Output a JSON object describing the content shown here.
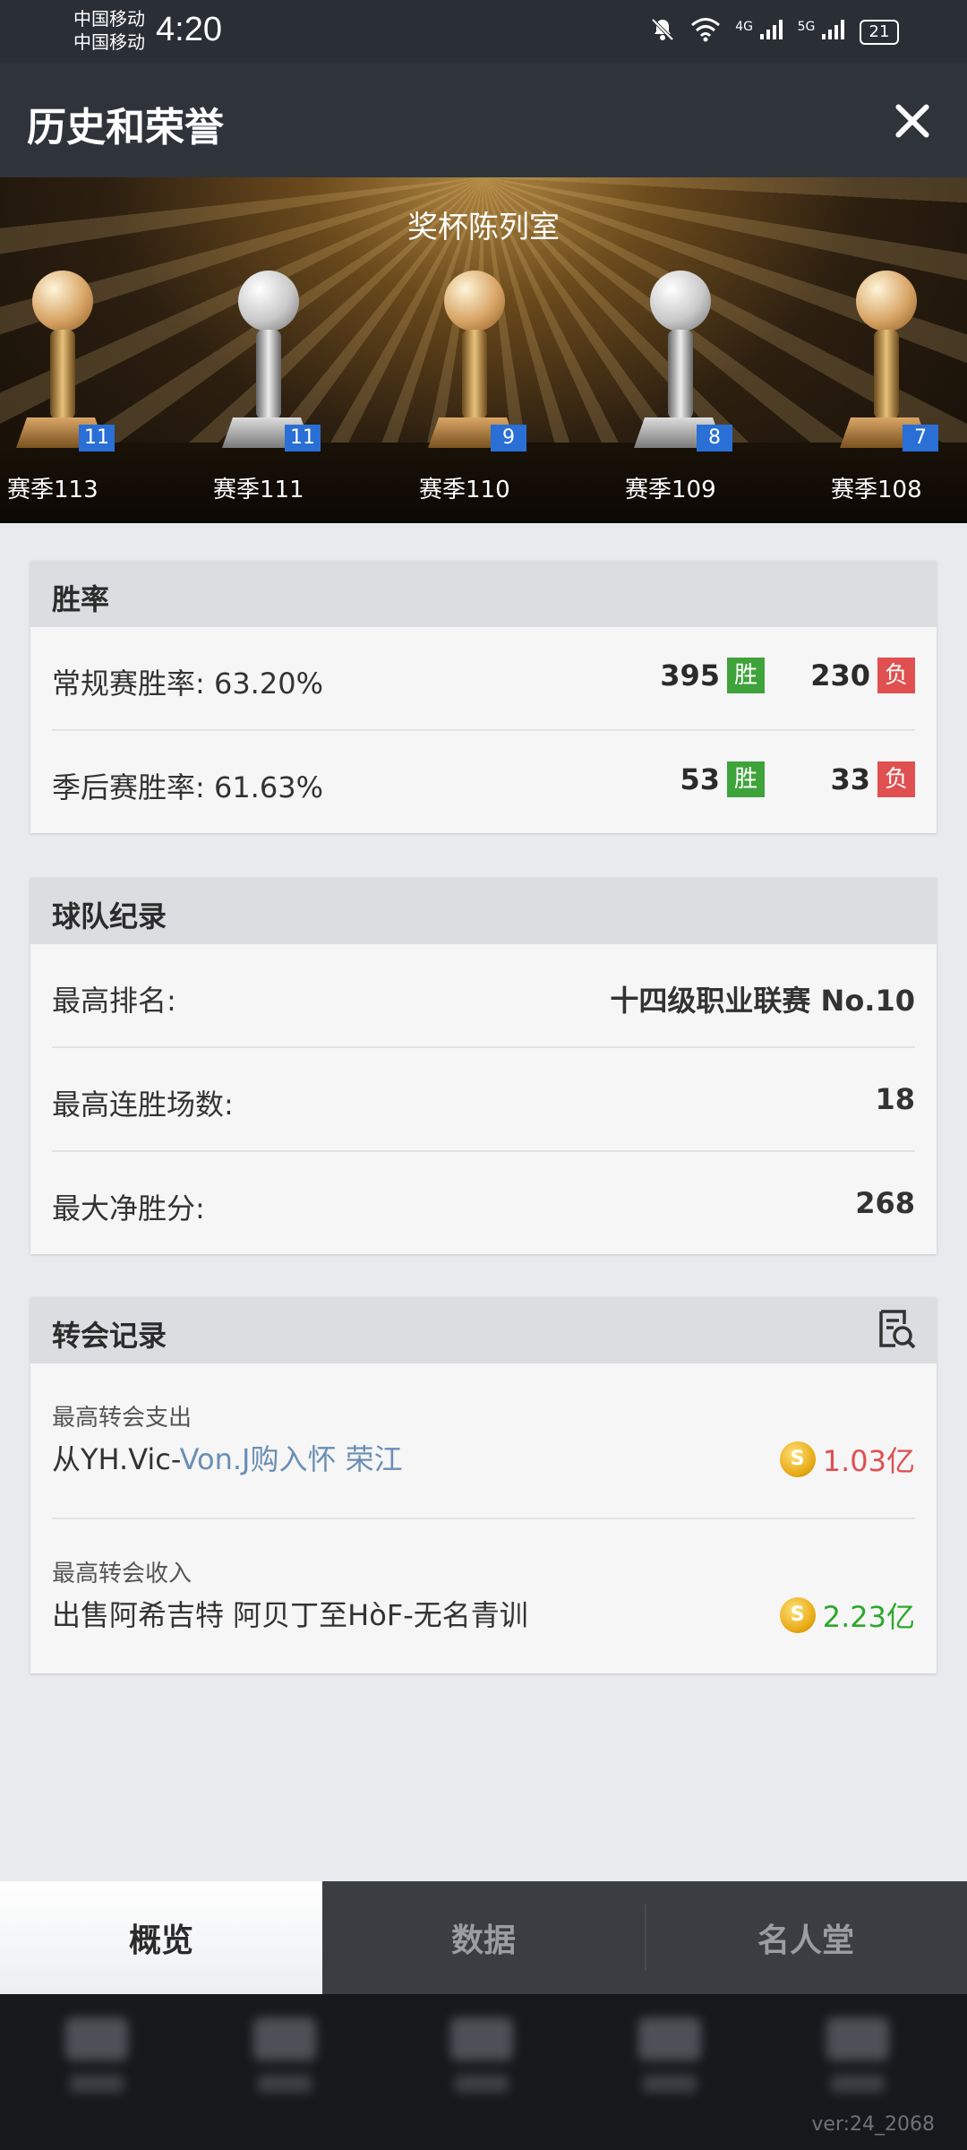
{
  "status_bar": {
    "carrier_1": "中国移动",
    "carrier_2": "中国移动",
    "time": "4:20",
    "network_1": "4G",
    "network_2": "5G",
    "battery": "21",
    "icons": [
      "mute-icon",
      "wifi-icon",
      "signal-icon",
      "signal-icon",
      "battery-icon"
    ]
  },
  "header": {
    "title": "历史和荣誉",
    "close_icon": "close-icon"
  },
  "trophy_room": {
    "title": "奖杯陈列室",
    "trophies": [
      {
        "season": "赛季113",
        "count": "11",
        "style": "gold"
      },
      {
        "season": "赛季111",
        "count": "11",
        "style": "silver"
      },
      {
        "season": "赛季110",
        "count": "9",
        "style": "gold"
      },
      {
        "season": "赛季109",
        "count": "8",
        "style": "silver"
      },
      {
        "season": "赛季108",
        "count": "7",
        "style": "gold"
      }
    ]
  },
  "win_rate": {
    "title": "胜率",
    "win_tag": "胜",
    "loss_tag": "负",
    "rows": [
      {
        "label": "常规赛胜率:  63.20%",
        "wins": "395",
        "losses": "230"
      },
      {
        "label": "季后赛胜率:  61.63%",
        "wins": "53",
        "losses": "33"
      }
    ]
  },
  "team_record": {
    "title": "球队纪录",
    "rows": [
      {
        "label": "最高排名:",
        "value": "十四级职业联赛 No.10"
      },
      {
        "label": "最高连胜场数:",
        "value": "18"
      },
      {
        "label": "最大净胜分:",
        "value": "268"
      }
    ]
  },
  "transfer_record": {
    "title": "转会记录",
    "icon": "search-document-icon",
    "rows": [
      {
        "label": "最高转会支出",
        "prefix": "从YH.Vic-",
        "link": "Von.J购入怀 荣江",
        "amount": "1.03亿",
        "amount_color": "#e05050"
      },
      {
        "label": "最高转会收入",
        "prefix": "出售阿希吉特 阿贝丁至HòF-无名青训",
        "link": "",
        "amount": "2.23亿",
        "amount_color": "#2ea82b"
      }
    ],
    "coin_symbol": "S"
  },
  "tabs": [
    "概览",
    "数据",
    "名人堂"
  ],
  "active_tab": "概览",
  "version": "ver:24_2068"
}
